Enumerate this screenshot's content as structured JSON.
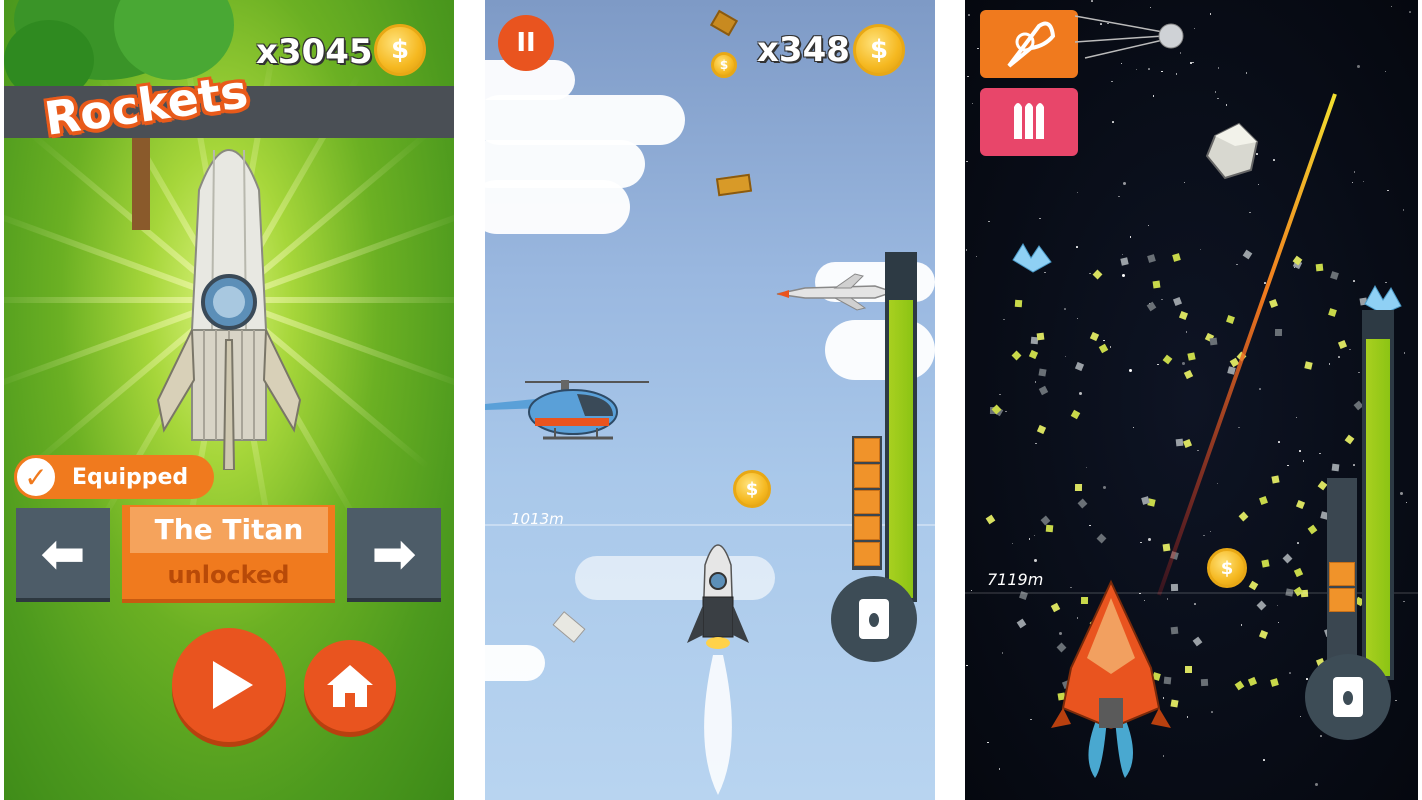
{
  "panel1": {
    "coin_count": "x3045",
    "coin_icon": "coin-icon",
    "title": "Rockets",
    "equipped_label": "Equipped",
    "rocket_name": "The Titan",
    "rocket_status": "unlocked",
    "prev_icon": "arrow-left-icon",
    "next_icon": "arrow-right-icon",
    "play_icon": "play-icon",
    "home_icon": "home-icon",
    "accent_color": "#f07a1e"
  },
  "panel2": {
    "coin_count": "x348",
    "distance_marker": "1013m",
    "pause_icon": "pause-icon",
    "fuel_icon": "fuel-can-icon",
    "fuel_level": 0.86,
    "boost_segments": 5
  },
  "panel3": {
    "distance_marker": "7119m",
    "powerup_1": "fire-powerup-icon",
    "powerup_2": "bullets-powerup-icon",
    "fuel_icon": "fuel-can-icon",
    "fuel_level": 0.92,
    "boost_segments": 2
  }
}
